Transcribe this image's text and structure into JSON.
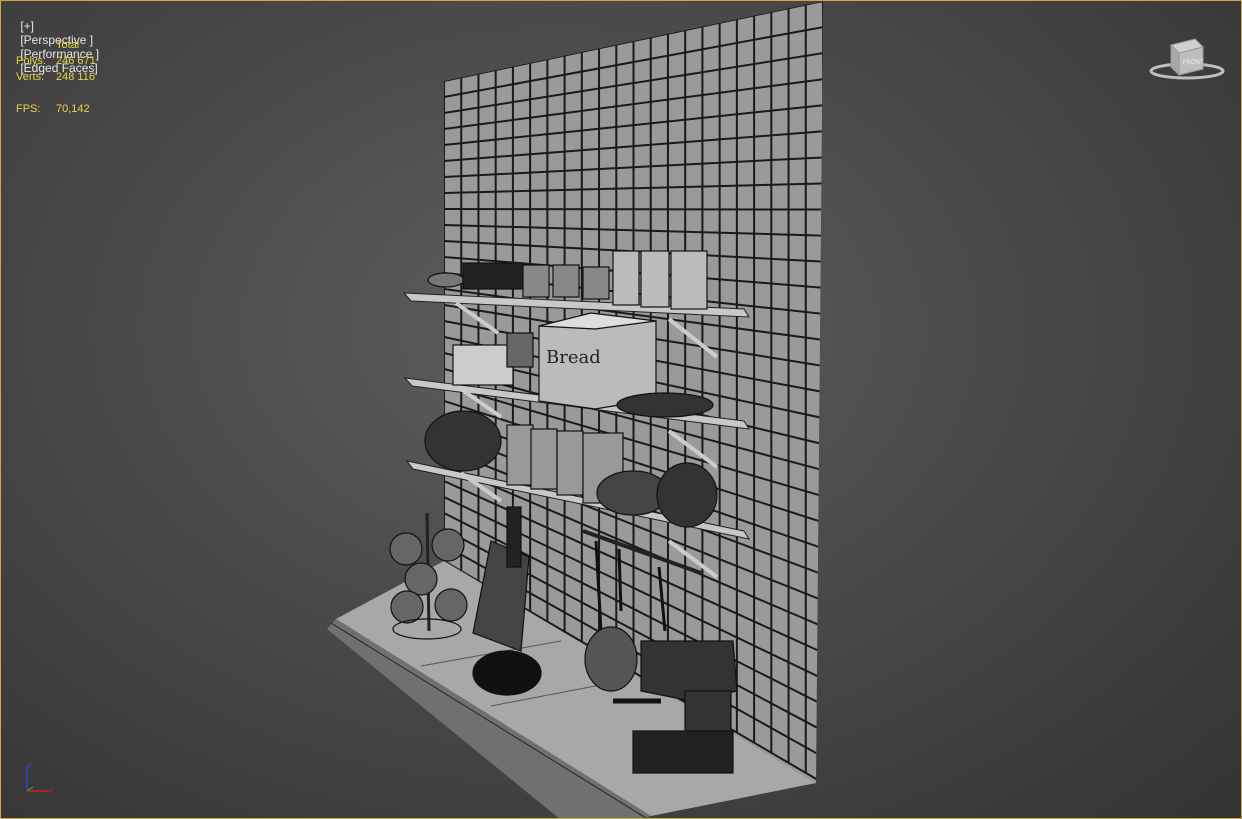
{
  "viewport": {
    "menu_plus": "[+]",
    "view_perspective": "[Perspective ]",
    "view_performance": "[Performance ]",
    "view_edged_faces": "[Edged Faces]"
  },
  "stats": {
    "header": "Total",
    "polys_label": "Polys:",
    "polys_value": "246 671",
    "verts_label": "Verts:",
    "verts_value": "248 116",
    "fps_label": "FPS:",
    "fps_value": "70,142"
  },
  "viewcube": {
    "face_label": "FRONT"
  },
  "axis": {
    "x": "x",
    "y": "y",
    "z": "z"
  },
  "scene": {
    "breadbox_text": "Bread"
  },
  "colors": {
    "stats_text": "#e8d64a",
    "viewport_border": "#c8a84a",
    "axis_x": "#d02020",
    "axis_y": "#20a020",
    "axis_z": "#3040d0"
  }
}
